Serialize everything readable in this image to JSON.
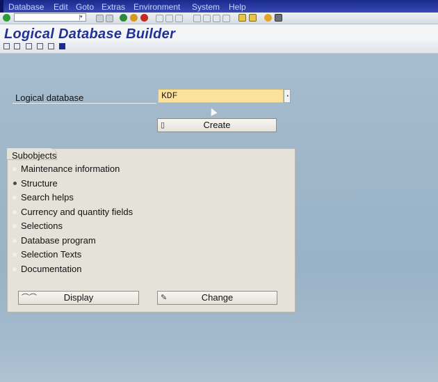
{
  "menubar": {
    "items": [
      "Database",
      "Edit",
      "Goto",
      "Extras",
      "Environment",
      "System",
      "Help"
    ]
  },
  "toolbar": {
    "command_field_value": "",
    "icons": [
      "enter-icon",
      "save-icon",
      "back-icon",
      "exit-icon",
      "cancel-icon",
      "print-icon",
      "find-icon",
      "find-next-icon",
      "first-page-icon",
      "previous-page-icon",
      "next-page-icon",
      "last-page-icon",
      "new-session-icon",
      "shortcut-icon",
      "help-icon",
      "layout-icon"
    ]
  },
  "title": {
    "text": "Logical Database Builder"
  },
  "app_toolbar": {
    "icons": [
      "other-object-icon",
      "display-change-icon",
      "delete-icon",
      "copy-icon",
      "hierarchy-icon",
      "info-icon"
    ]
  },
  "main": {
    "logical_database_label": "Logical database",
    "logical_database_value": "KDF",
    "create_label": "Create"
  },
  "subobjects": {
    "title": "Subobjects",
    "options": [
      {
        "label": "Maintenance information",
        "selected": false
      },
      {
        "label": "Structure",
        "selected": true
      },
      {
        "label": "Search helps",
        "selected": false
      },
      {
        "label": "Currency and quantity fields",
        "selected": false
      },
      {
        "label": "Selections",
        "selected": false
      },
      {
        "label": "Database program",
        "selected": false
      },
      {
        "label": "Selection Texts",
        "selected": false
      },
      {
        "label": "Documentation",
        "selected": false
      }
    ],
    "display_label": "Display",
    "change_label": "Change"
  },
  "colors": {
    "menubar": "#2b3da6",
    "title_text": "#21319a",
    "input_highlight": "#fbe29c",
    "background": "#a3bacc",
    "groupbox": "#e4e2d9"
  }
}
